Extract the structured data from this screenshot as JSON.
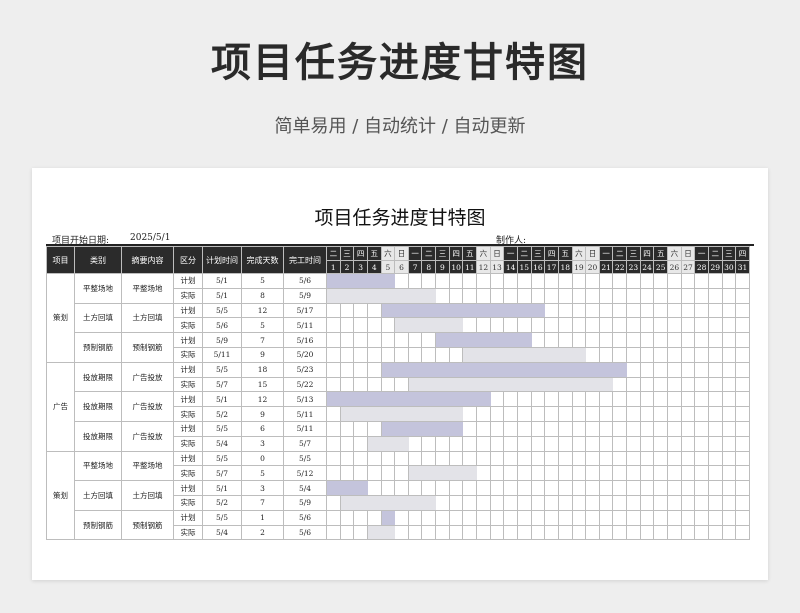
{
  "hero": {
    "title": "项目任务进度甘特图",
    "subtitle": "简单易用 / 自动统计 / 自动更新"
  },
  "sheet": {
    "title": "项目任务进度甘特图",
    "start_label": "项目开始日期:",
    "start_value": "2025/5/1",
    "maker_label": "制作人:"
  },
  "colors": {
    "header_bg": "#2b2b2b",
    "plan_bar": "#c4c4dc",
    "actual_bar": "#e3e3e8"
  },
  "headers": [
    "项目",
    "类别",
    "摘要内容",
    "区分",
    "计划时间",
    "完成天数",
    "完工时间"
  ],
  "weekdays": [
    "二",
    "三",
    "四",
    "五",
    "六",
    "日",
    "一",
    "二",
    "三",
    "四",
    "五",
    "六",
    "日",
    "一",
    "二",
    "三",
    "四",
    "五",
    "六",
    "日",
    "一",
    "二",
    "三",
    "四",
    "五",
    "六",
    "日",
    "一",
    "二",
    "三",
    "四"
  ],
  "days": [
    "1",
    "2",
    "3",
    "4",
    "5",
    "6",
    "7",
    "8",
    "9",
    "10",
    "11",
    "12",
    "13",
    "14",
    "15",
    "16",
    "17",
    "18",
    "19",
    "20",
    "21",
    "22",
    "23",
    "24",
    "25",
    "26",
    "27",
    "28",
    "29",
    "30",
    "31"
  ],
  "groups": [
    {
      "name": "策划",
      "tasks": [
        {
          "category": "平整场地",
          "summary": "平整场地",
          "rows": [
            {
              "type": "计划",
              "start": "5/1",
              "days": "5",
              "end": "5/6"
            },
            {
              "type": "实际",
              "start": "5/1",
              "days": "8",
              "end": "5/9"
            }
          ]
        },
        {
          "category": "土方回填",
          "summary": "土方回填",
          "rows": [
            {
              "type": "计划",
              "start": "5/5",
              "days": "12",
              "end": "5/17"
            },
            {
              "type": "实际",
              "start": "5/6",
              "days": "5",
              "end": "5/11"
            }
          ]
        },
        {
          "category": "预制钢筋",
          "summary": "预制钢筋",
          "rows": [
            {
              "type": "计划",
              "start": "5/9",
              "days": "7",
              "end": "5/16"
            },
            {
              "type": "实际",
              "start": "5/11",
              "days": "9",
              "end": "5/20"
            }
          ]
        }
      ]
    },
    {
      "name": "广告",
      "tasks": [
        {
          "category": "投放期限",
          "summary": "广告投放",
          "rows": [
            {
              "type": "计划",
              "start": "5/5",
              "days": "18",
              "end": "5/23"
            },
            {
              "type": "实际",
              "start": "5/7",
              "days": "15",
              "end": "5/22"
            }
          ]
        },
        {
          "category": "投放期限",
          "summary": "广告投放",
          "rows": [
            {
              "type": "计划",
              "start": "5/1",
              "days": "12",
              "end": "5/13"
            },
            {
              "type": "实际",
              "start": "5/2",
              "days": "9",
              "end": "5/11"
            }
          ]
        },
        {
          "category": "投放期限",
          "summary": "广告投放",
          "rows": [
            {
              "type": "计划",
              "start": "5/5",
              "days": "6",
              "end": "5/11"
            },
            {
              "type": "实际",
              "start": "5/4",
              "days": "3",
              "end": "5/7"
            }
          ]
        }
      ]
    },
    {
      "name": "策划",
      "tasks": [
        {
          "category": "平整场地",
          "summary": "平整场地",
          "rows": [
            {
              "type": "计划",
              "start": "5/5",
              "days": "0",
              "end": "5/5"
            },
            {
              "type": "实际",
              "start": "5/7",
              "days": "5",
              "end": "5/12"
            }
          ]
        },
        {
          "category": "土方回填",
          "summary": "土方回填",
          "rows": [
            {
              "type": "计划",
              "start": "5/1",
              "days": "3",
              "end": "5/4"
            },
            {
              "type": "实际",
              "start": "5/2",
              "days": "7",
              "end": "5/9"
            }
          ]
        },
        {
          "category": "预制钢筋",
          "summary": "预制钢筋",
          "rows": [
            {
              "type": "计划",
              "start": "5/5",
              "days": "1",
              "end": "5/6"
            },
            {
              "type": "实际",
              "start": "5/4",
              "days": "2",
              "end": "5/6"
            }
          ]
        }
      ]
    }
  ]
}
